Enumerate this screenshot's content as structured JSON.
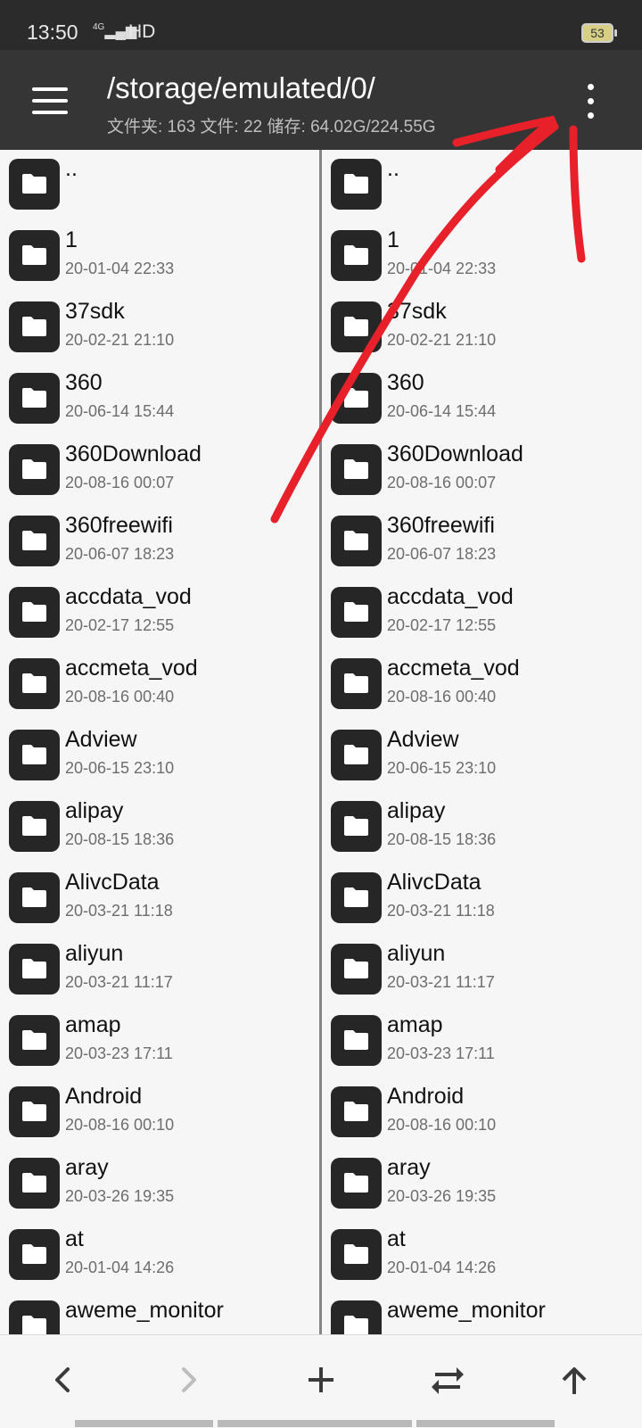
{
  "status_bar": {
    "time": "13:50",
    "network": "4G",
    "signal_icon": "signal-bars-icon",
    "hd": "HD",
    "battery": "53"
  },
  "app_bar": {
    "menu_icon": "hamburger-menu-icon",
    "path": "/storage/emulated/0/",
    "info": "文件夹: 163  文件: 22  储存: 64.02G/224.55G",
    "overflow_icon": "more-vertical-icon"
  },
  "folder_icon": "folder-icon",
  "left_pane": {
    "items": [
      {
        "name": "..",
        "date": ""
      },
      {
        "name": "1",
        "date": "20-01-04 22:33"
      },
      {
        "name": "37sdk",
        "date": "20-02-21 21:10"
      },
      {
        "name": "360",
        "date": "20-06-14 15:44"
      },
      {
        "name": "360Download",
        "date": "20-08-16 00:07"
      },
      {
        "name": "360freewifi",
        "date": "20-06-07 18:23"
      },
      {
        "name": "accdata_vod",
        "date": "20-02-17 12:55"
      },
      {
        "name": "accmeta_vod",
        "date": "20-08-16 00:40"
      },
      {
        "name": "Adview",
        "date": "20-06-15 23:10"
      },
      {
        "name": "alipay",
        "date": "20-08-15 18:36"
      },
      {
        "name": "AlivcData",
        "date": "20-03-21 11:18"
      },
      {
        "name": "aliyun",
        "date": "20-03-21 11:17"
      },
      {
        "name": "amap",
        "date": "20-03-23 17:11"
      },
      {
        "name": "Android",
        "date": "20-08-16 00:10"
      },
      {
        "name": "aray",
        "date": "20-03-26 19:35"
      },
      {
        "name": "at",
        "date": "20-01-04 14:26"
      },
      {
        "name": "aweme_monitor",
        "date": ""
      }
    ]
  },
  "right_pane": {
    "items": [
      {
        "name": "..",
        "date": ""
      },
      {
        "name": "1",
        "date": "20-01-04 22:33"
      },
      {
        "name": "37sdk",
        "date": "20-02-21 21:10"
      },
      {
        "name": "360",
        "date": "20-06-14 15:44"
      },
      {
        "name": "360Download",
        "date": "20-08-16 00:07"
      },
      {
        "name": "360freewifi",
        "date": "20-06-07 18:23"
      },
      {
        "name": "accdata_vod",
        "date": "20-02-17 12:55"
      },
      {
        "name": "accmeta_vod",
        "date": "20-08-16 00:40"
      },
      {
        "name": "Adview",
        "date": "20-06-15 23:10"
      },
      {
        "name": "alipay",
        "date": "20-08-15 18:36"
      },
      {
        "name": "AlivcData",
        "date": "20-03-21 11:18"
      },
      {
        "name": "aliyun",
        "date": "20-03-21 11:17"
      },
      {
        "name": "amap",
        "date": "20-03-23 17:11"
      },
      {
        "name": "Android",
        "date": "20-08-16 00:10"
      },
      {
        "name": "aray",
        "date": "20-03-26 19:35"
      },
      {
        "name": "at",
        "date": "20-01-04 14:26"
      },
      {
        "name": "aweme_monitor",
        "date": ""
      }
    ]
  },
  "bottom_bar": {
    "buttons": [
      {
        "icon": "back-arrow-icon",
        "enabled": true
      },
      {
        "icon": "forward-arrow-icon",
        "enabled": false
      },
      {
        "icon": "plus-icon",
        "enabled": true
      },
      {
        "icon": "swap-arrows-icon",
        "enabled": true
      },
      {
        "icon": "up-arrow-icon",
        "enabled": true
      }
    ]
  },
  "colors": {
    "app_bar": "#353535",
    "status_bar": "#2b2b2b",
    "annotation": "#e8202a"
  }
}
